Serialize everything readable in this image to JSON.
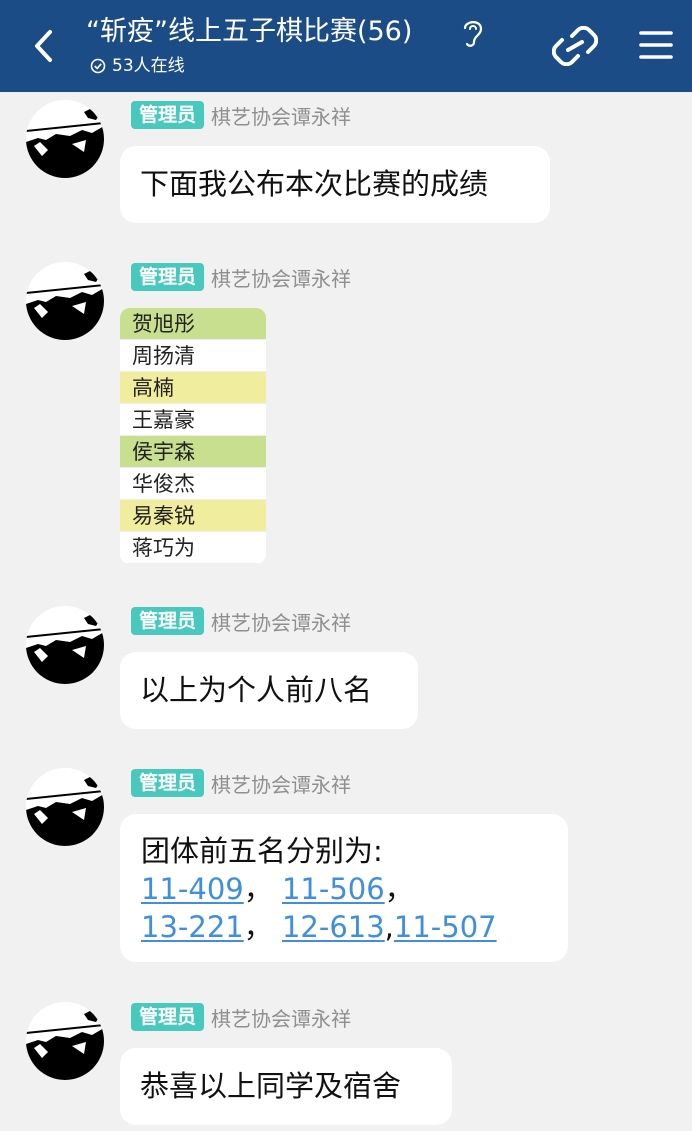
{
  "header": {
    "title": "“斩疫”线上五子棋比赛(56)",
    "online": "53人在线"
  },
  "messages": [
    {
      "badge": "管理员",
      "sender": "棋艺协会谭永祥",
      "text": "下面我公布本次比赛的成绩"
    },
    {
      "badge": "管理员",
      "sender": "棋艺协会谭永祥",
      "image_rows": [
        {
          "name": "贺旭彤",
          "color": "#c7df8f"
        },
        {
          "name": "周扬清",
          "color": "#ffffff"
        },
        {
          "name": "高楠",
          "color": "#f0ed9e"
        },
        {
          "name": "王嘉豪",
          "color": "#ffffff"
        },
        {
          "name": "侯宇森",
          "color": "#c7df8f"
        },
        {
          "name": "华俊杰",
          "color": "#ffffff"
        },
        {
          "name": "易秦锐",
          "color": "#f0ed9e"
        },
        {
          "name": "蒋巧为",
          "color": "#ffffff"
        }
      ]
    },
    {
      "badge": "管理员",
      "sender": "棋艺协会谭永祥",
      "text": "以上为个人前八名"
    },
    {
      "badge": "管理员",
      "sender": "棋艺协会谭永祥",
      "text": "团体前五名分别为:",
      "links": [
        "11-409",
        "11-506",
        "13-221",
        "12-613",
        "11-507"
      ],
      "sep_cn": "，",
      "sep_en": ","
    },
    {
      "badge": "管理员",
      "sender": "棋艺协会谭永祥",
      "text": "恭喜以上同学及宿舍"
    }
  ]
}
